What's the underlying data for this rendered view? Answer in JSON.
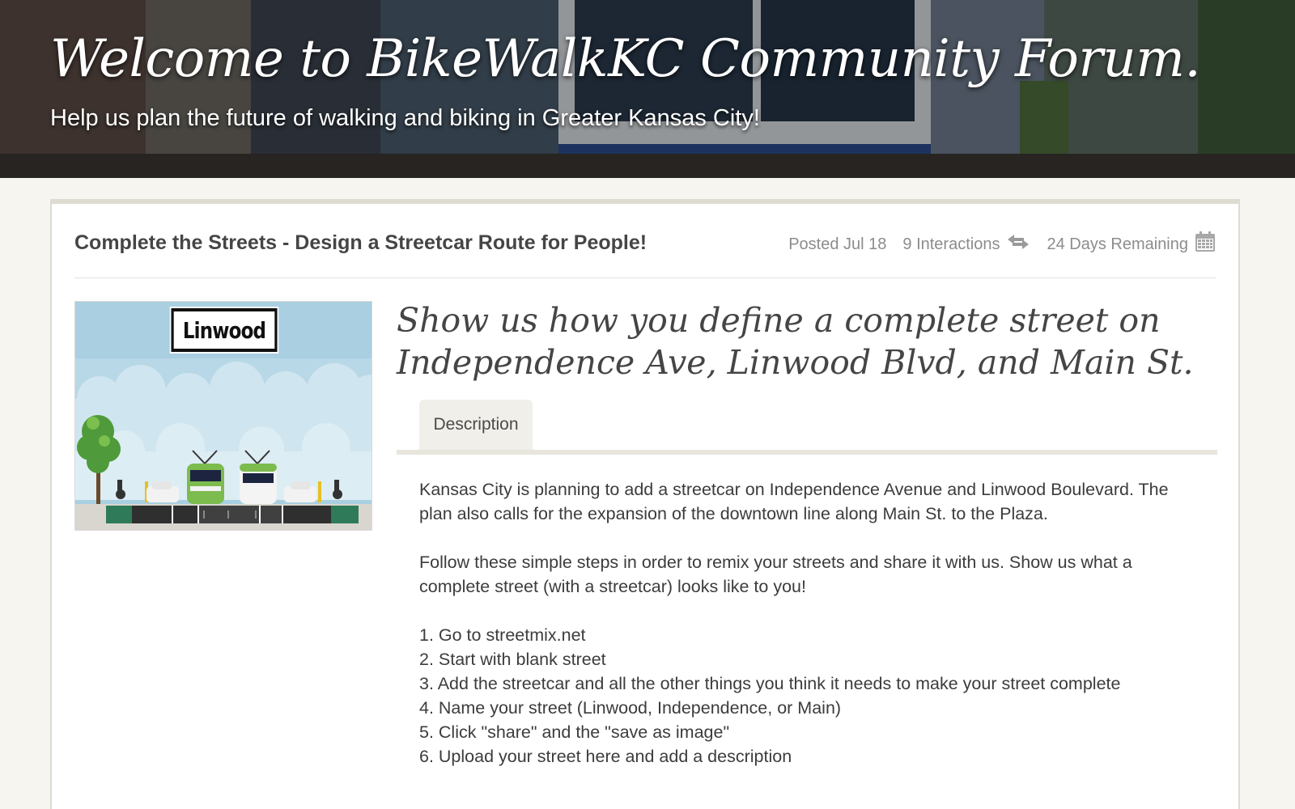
{
  "banner": {
    "title": "Welcome to BikeWalkKC Community Forum.",
    "subtitle": "Help us plan the future of walking and biking in Greater Kansas City!"
  },
  "post": {
    "title": "Complete the Streets - Design a Streetcar Route for People!",
    "posted": "Posted Jul 18",
    "interactions": "9 Interactions",
    "remaining": "24 Days Remaining",
    "image_sign": "Linwood",
    "headline": "Show us how you define a complete street on Independence Ave, Linwood Blvd, and Main St.",
    "tab_label": "Description",
    "paragraphs": [
      "Kansas City is planning to add a streetcar on Independence Avenue and Linwood Boulevard. The plan also calls for the expansion of the downtown line along Main St. to the Plaza.",
      "Follow these simple steps in order to remix your streets and share it with us. Show us what a complete street (with a streetcar) looks like to you!"
    ],
    "steps": [
      "1. Go to streetmix.net",
      "2. Start with blank street",
      "3. Add the streetcar and all the other things you think it needs to make your street complete",
      "4. Name your street (Linwood, Independence, or Main)",
      "5. Click \"share\" and the \"save as image\"",
      "6. Upload your street here and add a description"
    ]
  },
  "icons": {
    "interactions": "arrows-exchange-icon",
    "remaining": "calendar-icon"
  },
  "colors": {
    "page_bg": "#f6f5f0",
    "card_border": "#dedbd0",
    "muted_text": "#8c8c8c",
    "tab_bg": "#f0efe9"
  }
}
